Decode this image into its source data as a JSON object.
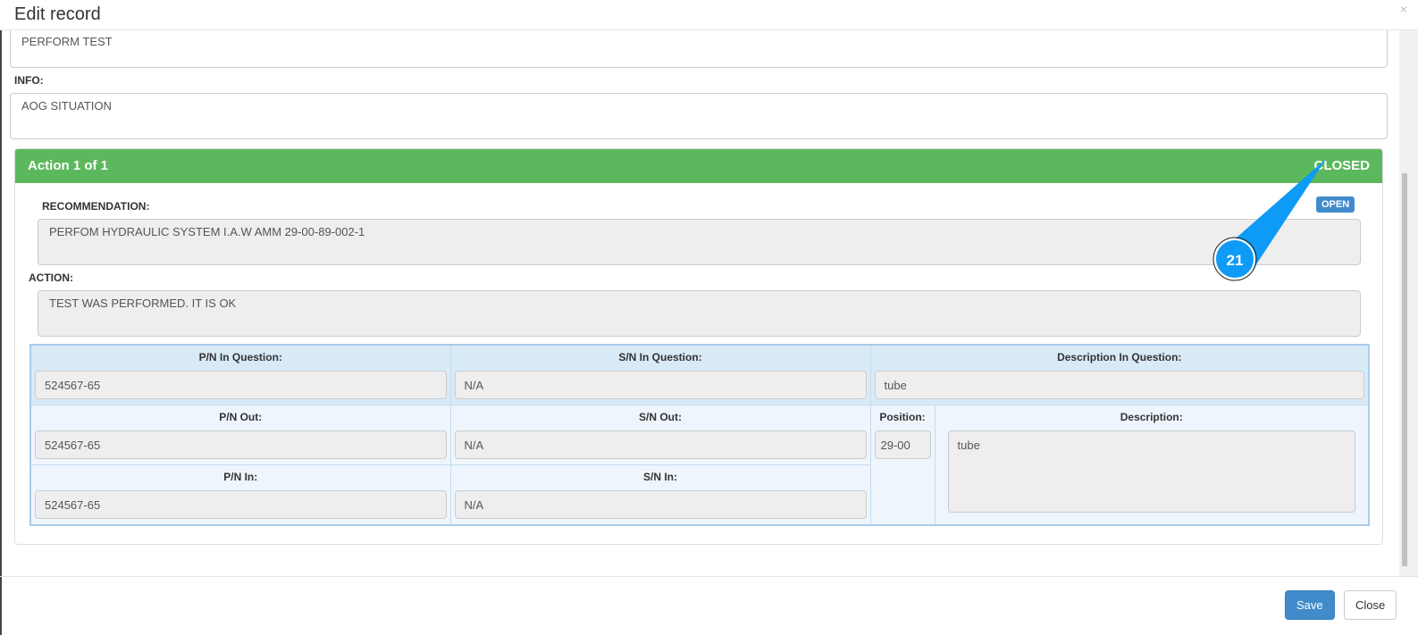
{
  "modal": {
    "title": "Edit record",
    "close_icon": "×"
  },
  "fields": {
    "description_value": "PERFORM TEST",
    "info_label": "INFO:",
    "info_value": "AOG SITUATION"
  },
  "action_panel": {
    "title": "Action 1 of 1",
    "status": "CLOSED",
    "open_button": "OPEN",
    "recommendation_label": "RECOMMENDATION:",
    "recommendation_value": "PERFOM HYDRAULIC SYSTEM I.A.W AMM 29-00-89-002-1",
    "action_label": "ACTION:",
    "action_value": "TEST WAS PERFORMED. IT IS OK"
  },
  "parts": {
    "pn_q_label": "P/N In Question:",
    "pn_q": "524567-65",
    "sn_q_label": "S/N In Question:",
    "sn_q": "N/A",
    "desc_q_label": "Description In Question:",
    "desc_q": "tube",
    "pn_out_label": "P/N Out:",
    "pn_out": "524567-65",
    "sn_out_label": "S/N Out:",
    "sn_out": "N/A",
    "position_label": "Position:",
    "position": "29-00",
    "desc_label": "Description:",
    "desc": "tube",
    "pn_in_label": "P/N In:",
    "pn_in": "524567-65",
    "sn_in_label": "S/N In:",
    "sn_in": "N/A"
  },
  "footer": {
    "save": "Save",
    "close": "Close"
  },
  "annotation": {
    "number": "21",
    "color": "#0e9bf5"
  }
}
